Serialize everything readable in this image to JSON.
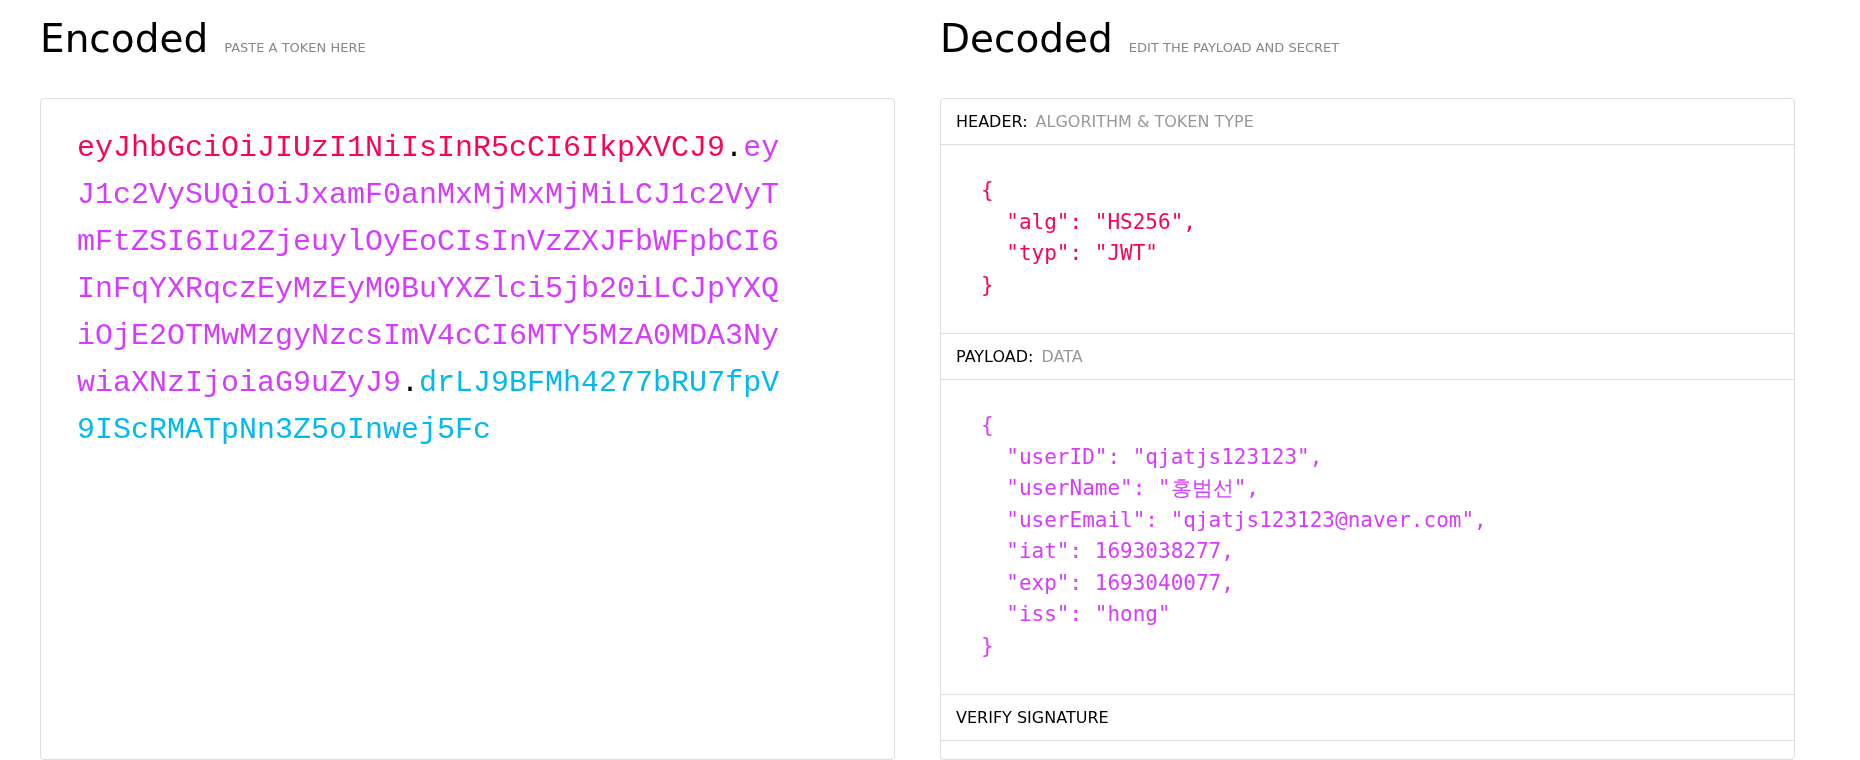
{
  "encoded": {
    "title": "Encoded",
    "subtitle": "PASTE A TOKEN HERE",
    "token_segments": [
      {
        "kind": "part",
        "text": "eyJhbGciOiJIUzI1NiIsInR5cCI6IkpXVCJ9",
        "color": "#fb015b"
      },
      {
        "kind": "dot",
        "text": "."
      },
      {
        "kind": "part",
        "text": "eyJ1c2VySUQiOiJxamF0anMxMjMxMjMiLCJ1c2VyTmFtZSI6Iu2ZjeuylOyEoCIsInVzZXJFbWFpbCI6InFqYXRqczEyMzEyM0BuYXZlci5jb20iLCJpYXQiOjE2OTMwMzgyNzcsImV4cCI6MTY5MzA0MDA3NywiaXNzIjoiaG9uZyJ9",
        "color": "#d63aff"
      },
      {
        "kind": "dot",
        "text": "."
      },
      {
        "kind": "part",
        "text": "drLJ9BFMh4277bRU7fpV9IScRMATpNn3Z5oInwej5Fc",
        "color": "#00b9f1"
      }
    ]
  },
  "decoded": {
    "title": "Decoded",
    "subtitle": "EDIT THE PAYLOAD AND SECRET",
    "sections": [
      {
        "label": "HEADER:",
        "sublabel": "ALGORITHM & TOKEN TYPE",
        "color": "#fb015b",
        "code_lines": [
          "{",
          "  \"alg\": \"HS256\",",
          "  \"typ\": \"JWT\"",
          "}"
        ]
      },
      {
        "label": "PAYLOAD:",
        "sublabel": "DATA",
        "color": "#d63aff",
        "code_lines": [
          "{",
          "  \"userID\": \"qjatjs123123\",",
          "  \"userName\": \"홍범선\",",
          "  \"userEmail\": \"qjatjs123123@naver.com\",",
          "  \"iat\": 1693038277,",
          "  \"exp\": 1693040077,",
          "  \"iss\": \"hong\"",
          "}"
        ]
      },
      {
        "label": "VERIFY SIGNATURE"
      }
    ]
  }
}
